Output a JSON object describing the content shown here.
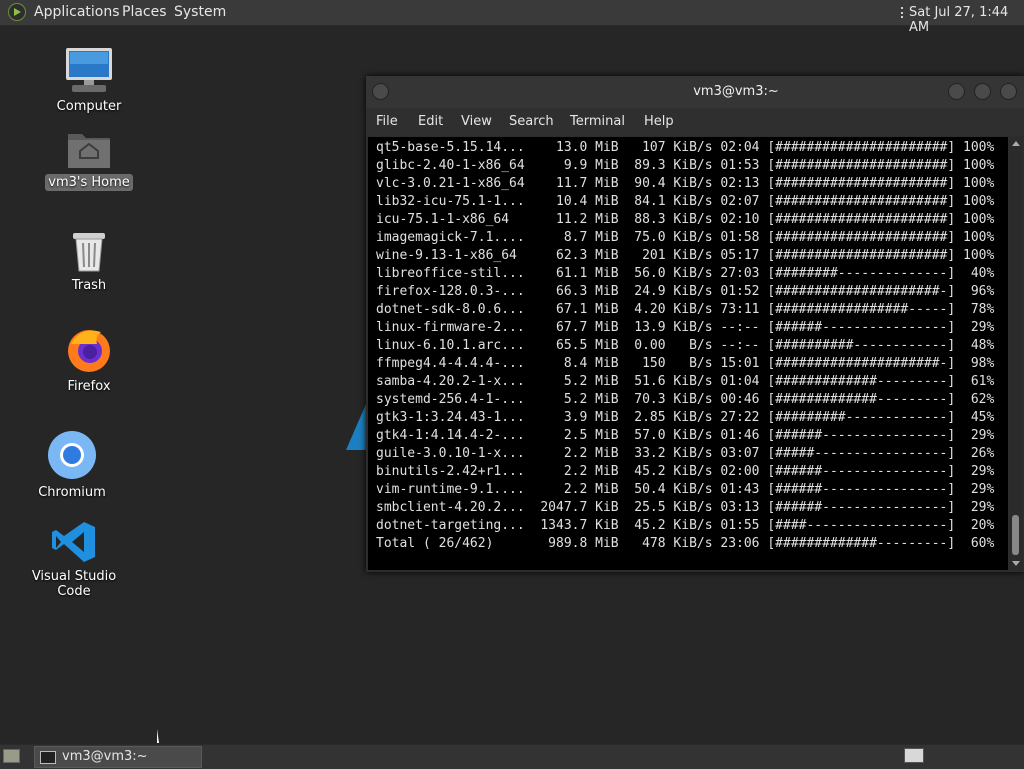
{
  "top_panel": {
    "menus": [
      "Applications",
      "Places",
      "System"
    ],
    "clock": "Sat Jul 27,  1:44 AM"
  },
  "desktop": {
    "icons": [
      {
        "label": "Computer",
        "icon": "computer-icon"
      },
      {
        "label": "vm3's Home",
        "icon": "home-folder-icon"
      },
      {
        "label": "Trash",
        "icon": "trash-icon"
      },
      {
        "label": "Firefox",
        "icon": "firefox-icon"
      },
      {
        "label": "Chromium",
        "icon": "chromium-icon"
      },
      {
        "label": "Visual Studio Code",
        "icon": "vscode-icon"
      }
    ]
  },
  "terminal": {
    "title": "vm3@vm3:~",
    "menu": [
      "File",
      "Edit",
      "View",
      "Search",
      "Terminal",
      "Help"
    ],
    "lines": [
      "qt5-base-5.15.14...    13.0 MiB   107 KiB/s 02:04 [######################] 100%",
      "glibc-2.40-1-x86_64     9.9 MiB  89.3 KiB/s 01:53 [######################] 100%",
      "vlc-3.0.21-1-x86_64    11.7 MiB  90.4 KiB/s 02:13 [######################] 100%",
      "lib32-icu-75.1-1...    10.4 MiB  84.1 KiB/s 02:07 [######################] 100%",
      "icu-75.1-1-x86_64      11.2 MiB  88.3 KiB/s 02:10 [######################] 100%",
      "imagemagick-7.1....     8.7 MiB  75.0 KiB/s 01:58 [######################] 100%",
      "wine-9.13-1-x86_64     62.3 MiB   201 KiB/s 05:17 [######################] 100%",
      "libreoffice-stil...    61.1 MiB  56.0 KiB/s 27:03 [########--------------]  40%",
      "firefox-128.0.3-...    66.3 MiB  24.9 KiB/s 01:52 [#####################-]  96%",
      "dotnet-sdk-8.0.6...    67.1 MiB  4.20 KiB/s 73:11 [#################-----]  78%",
      "linux-firmware-2...    67.7 MiB  13.9 KiB/s --:-- [######----------------]  29%",
      "linux-6.10.1.arc...    65.5 MiB  0.00   B/s --:-- [##########------------]  48%",
      "ffmpeg4.4-4.4.4-...     8.4 MiB   150   B/s 15:01 [#####################-]  98%",
      "samba-4.20.2-1-x...     5.2 MiB  51.6 KiB/s 01:04 [#############---------]  61%",
      "systemd-256.4-1-...     5.2 MiB  70.3 KiB/s 00:46 [#############---------]  62%",
      "gtk3-1:3.24.43-1...     3.9 MiB  2.85 KiB/s 27:22 [#########-------------]  45%",
      "gtk4-1:4.14.4-2-...     2.5 MiB  57.0 KiB/s 01:46 [######----------------]  29%",
      "guile-3.0.10-1-x...     2.2 MiB  33.2 KiB/s 03:07 [#####-----------------]  26%",
      "binutils-2.42+r1...     2.2 MiB  45.2 KiB/s 02:00 [######----------------]  29%",
      "vim-runtime-9.1....     2.2 MiB  50.4 KiB/s 01:43 [######----------------]  29%",
      "smbclient-4.20.2...  2047.7 KiB  25.5 KiB/s 03:13 [######----------------]  29%",
      "dotnet-targeting...  1343.7 KiB  45.2 KiB/s 01:55 [####------------------]  20%",
      "Total ( 26/462)       989.8 MiB   478 KiB/s 23:06 [#############---------]  60%"
    ]
  },
  "taskbar": {
    "tasks": [
      {
        "label": "vm3@vm3:~"
      }
    ]
  }
}
